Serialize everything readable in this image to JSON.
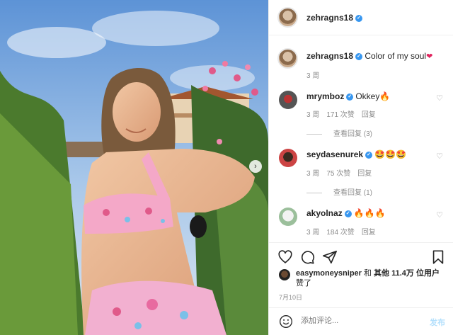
{
  "header": {
    "username": "zehragns18"
  },
  "caption": {
    "username": "zehragns18",
    "text": "Color of my soul",
    "emoji": "❤",
    "time": "3 周"
  },
  "comments": [
    {
      "username": "mrymboz",
      "text": "Okkey🔥",
      "time": "3 周",
      "likes": "171 次赞",
      "reply": "回复",
      "view_replies": "查看回复 (3)"
    },
    {
      "username": "seydasenurek",
      "text": "🤩🤩🤩",
      "time": "3 周",
      "likes": "75 次赞",
      "reply": "回复",
      "view_replies": "查看回复 (1)"
    },
    {
      "username": "akyolnaz",
      "text": "🔥🔥🔥",
      "time": "3 周",
      "likes": "184 次赞",
      "reply": "回复"
    }
  ],
  "likes": {
    "user": "easymoneysniper",
    "connector": "和",
    "others": "其他 11.4万 位用户",
    "suffix": "赞了"
  },
  "date": "7月10日",
  "add_comment": {
    "placeholder": "添加评论...",
    "post_label": "发布"
  },
  "colors": {
    "verified": "#3897f0",
    "heart": "#e0245e",
    "post_disabled": "#b2dffc"
  },
  "icons": [
    "heart-icon",
    "comment-icon",
    "share-icon",
    "bookmark-icon",
    "emoji-icon",
    "next-arrow-icon",
    "verified-icon"
  ]
}
